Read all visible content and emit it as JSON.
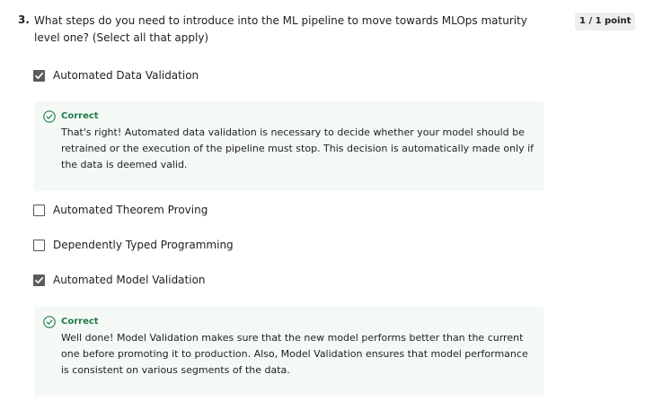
{
  "question": {
    "number": "3.",
    "text": "What steps do you need to introduce into the ML pipeline to move towards MLOps maturity level one? (Select all that apply)",
    "points": "1 / 1 point"
  },
  "options": [
    {
      "label": "Automated Data Validation",
      "checked": true
    },
    {
      "label": "Automated Theorem Proving",
      "checked": false
    },
    {
      "label": "Dependently Typed Programming",
      "checked": false
    },
    {
      "label": "Automated Model Validation",
      "checked": true
    }
  ],
  "feedback": [
    {
      "status": "Correct",
      "text": "That's right! Automated data validation is necessary to decide whether your model should be retrained or the execution of the pipeline must stop. This decision is automatically made only if the data is deemed valid."
    },
    {
      "status": "Correct",
      "text": "Well done! Model Validation makes sure that the new model performs better than the current one before promoting it to production. Also, Model Validation ensures that model performance is consistent on various segments of the data."
    }
  ],
  "colors": {
    "correct": "#1e7b47",
    "feedback_bg": "#f4f9f6",
    "checkbox_checked": "#5c5c5c"
  },
  "icons": {
    "checkmark": "check-icon",
    "correct": "check-circle-icon"
  }
}
